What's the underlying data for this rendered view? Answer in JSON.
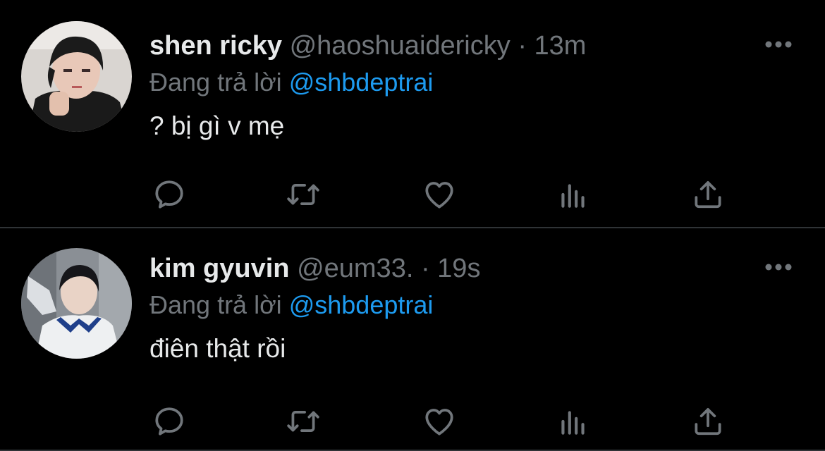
{
  "tweets": [
    {
      "display_name": "shen ricky",
      "handle": "@haoshuaidericky",
      "separator": "·",
      "time": "13m",
      "reply_prefix": "Đang trả lời",
      "reply_to": "@shbdeptrai",
      "text": "? bị gì v mẹ",
      "avatar": "profile-photo"
    },
    {
      "display_name": "kim gyuvin",
      "handle": "@eum33.",
      "separator": "·",
      "time": "19s",
      "reply_prefix": "Đang trả lời",
      "reply_to": "@shbdeptrai",
      "text": "điên thật rồi",
      "avatar": "profile-photo"
    }
  ],
  "icons": {
    "more": "more-icon",
    "reply": "reply-icon",
    "retweet": "retweet-icon",
    "like": "like-icon",
    "analytics": "analytics-icon",
    "share": "share-icon"
  },
  "colors": {
    "background": "#000000",
    "text_primary": "#e7e9ea",
    "text_secondary": "#71767b",
    "accent": "#1d9bf0",
    "divider": "#2f3336"
  }
}
